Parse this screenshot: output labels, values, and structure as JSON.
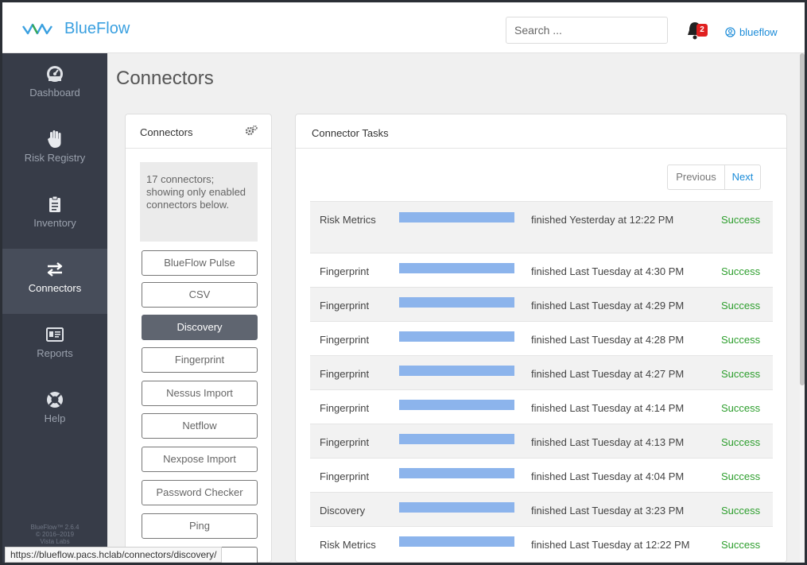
{
  "app": {
    "logo_text": "BlueFlow"
  },
  "header": {
    "search_placeholder": "Search ...",
    "notification_count": "2",
    "username": "blueflow"
  },
  "sidebar": {
    "items": [
      {
        "label": "Dashboard",
        "icon": "dashboard-icon",
        "active": false
      },
      {
        "label": "Risk Registry",
        "icon": "hand-icon",
        "active": false
      },
      {
        "label": "Inventory",
        "icon": "clipboard-icon",
        "active": false
      },
      {
        "label": "Connectors",
        "icon": "exchange-icon",
        "active": true
      },
      {
        "label": "Reports",
        "icon": "id-card-icon",
        "active": false
      },
      {
        "label": "Help",
        "icon": "lifebuoy-icon",
        "active": false
      }
    ],
    "footer": [
      "BlueFlow™ 2.6.4",
      "© 2016–2019",
      "Vista Labs"
    ]
  },
  "page": {
    "title": "Connectors"
  },
  "connectors_panel": {
    "title": "Connectors",
    "summary": "17 connectors; showing only enabled connectors below.",
    "items": [
      {
        "label": "BlueFlow Pulse",
        "active": false
      },
      {
        "label": "CSV",
        "active": false
      },
      {
        "label": "Discovery",
        "active": true
      },
      {
        "label": "Fingerprint",
        "active": false
      },
      {
        "label": "Nessus Import",
        "active": false
      },
      {
        "label": "Netflow",
        "active": false
      },
      {
        "label": "Nexpose Import",
        "active": false
      },
      {
        "label": "Password Checker",
        "active": false
      },
      {
        "label": "Ping",
        "active": false
      }
    ]
  },
  "tasks_panel": {
    "title": "Connector Tasks",
    "pager": {
      "previous": "Previous",
      "next": "Next"
    },
    "rows": [
      {
        "name": "Risk Metrics",
        "time": "finished Yesterday at 12:22 PM",
        "status": "Success",
        "progress": 1.0
      },
      {
        "name": "Fingerprint",
        "time": "finished Last Tuesday at 4:30 PM",
        "status": "Success",
        "progress": 1.0
      },
      {
        "name": "Fingerprint",
        "time": "finished Last Tuesday at 4:29 PM",
        "status": "Success",
        "progress": 1.0
      },
      {
        "name": "Fingerprint",
        "time": "finished Last Tuesday at 4:28 PM",
        "status": "Success",
        "progress": 1.0
      },
      {
        "name": "Fingerprint",
        "time": "finished Last Tuesday at 4:27 PM",
        "status": "Success",
        "progress": 1.0
      },
      {
        "name": "Fingerprint",
        "time": "finished Last Tuesday at 4:14 PM",
        "status": "Success",
        "progress": 1.0
      },
      {
        "name": "Fingerprint",
        "time": "finished Last Tuesday at 4:13 PM",
        "status": "Success",
        "progress": 1.0
      },
      {
        "name": "Fingerprint",
        "time": "finished Last Tuesday at 4:04 PM",
        "status": "Success",
        "progress": 1.0
      },
      {
        "name": "Discovery",
        "time": "finished Last Tuesday at 3:23 PM",
        "status": "Success",
        "progress": 1.0
      },
      {
        "name": "Risk Metrics",
        "time": "finished Last Tuesday at 12:22 PM",
        "status": "Success",
        "progress": 1.0
      }
    ]
  },
  "statusbar": {
    "url": "https://blueflow.pacs.hclab/connectors/discovery/"
  },
  "colors": {
    "accent": "#1a8bd8",
    "sidebar_bg": "#373c48",
    "success": "#2d9e2d",
    "progress": "#8cb4ec"
  }
}
